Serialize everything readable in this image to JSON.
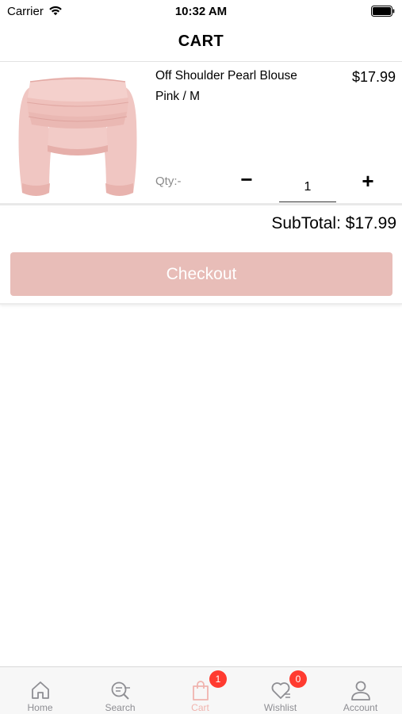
{
  "status_bar": {
    "carrier": "Carrier",
    "time": "10:32 AM"
  },
  "nav": {
    "title": "CART"
  },
  "cart_item": {
    "name": "Off Shoulder Pearl Blouse",
    "variant": "Pink / M",
    "price": "$17.99",
    "qty_label": "Qty:-",
    "qty_minus": "−",
    "qty_value": "1",
    "qty_plus": "+",
    "image_icon": "pink-blouse-product-image"
  },
  "summary": {
    "subtotal": "SubTotal: $17.99",
    "checkout_label": "Checkout"
  },
  "colors": {
    "accent": "#e8bdb8",
    "active_tab": "#f0b4ae",
    "badge": "#ff3b30"
  },
  "tabs": [
    {
      "label": "Home",
      "icon": "home-icon"
    },
    {
      "label": "Search",
      "icon": "search-icon"
    },
    {
      "label": "Cart",
      "icon": "bag-icon",
      "badge": "1"
    },
    {
      "label": "Wishlist",
      "icon": "heart-icon",
      "badge": "0"
    },
    {
      "label": "Account",
      "icon": "person-icon"
    }
  ]
}
